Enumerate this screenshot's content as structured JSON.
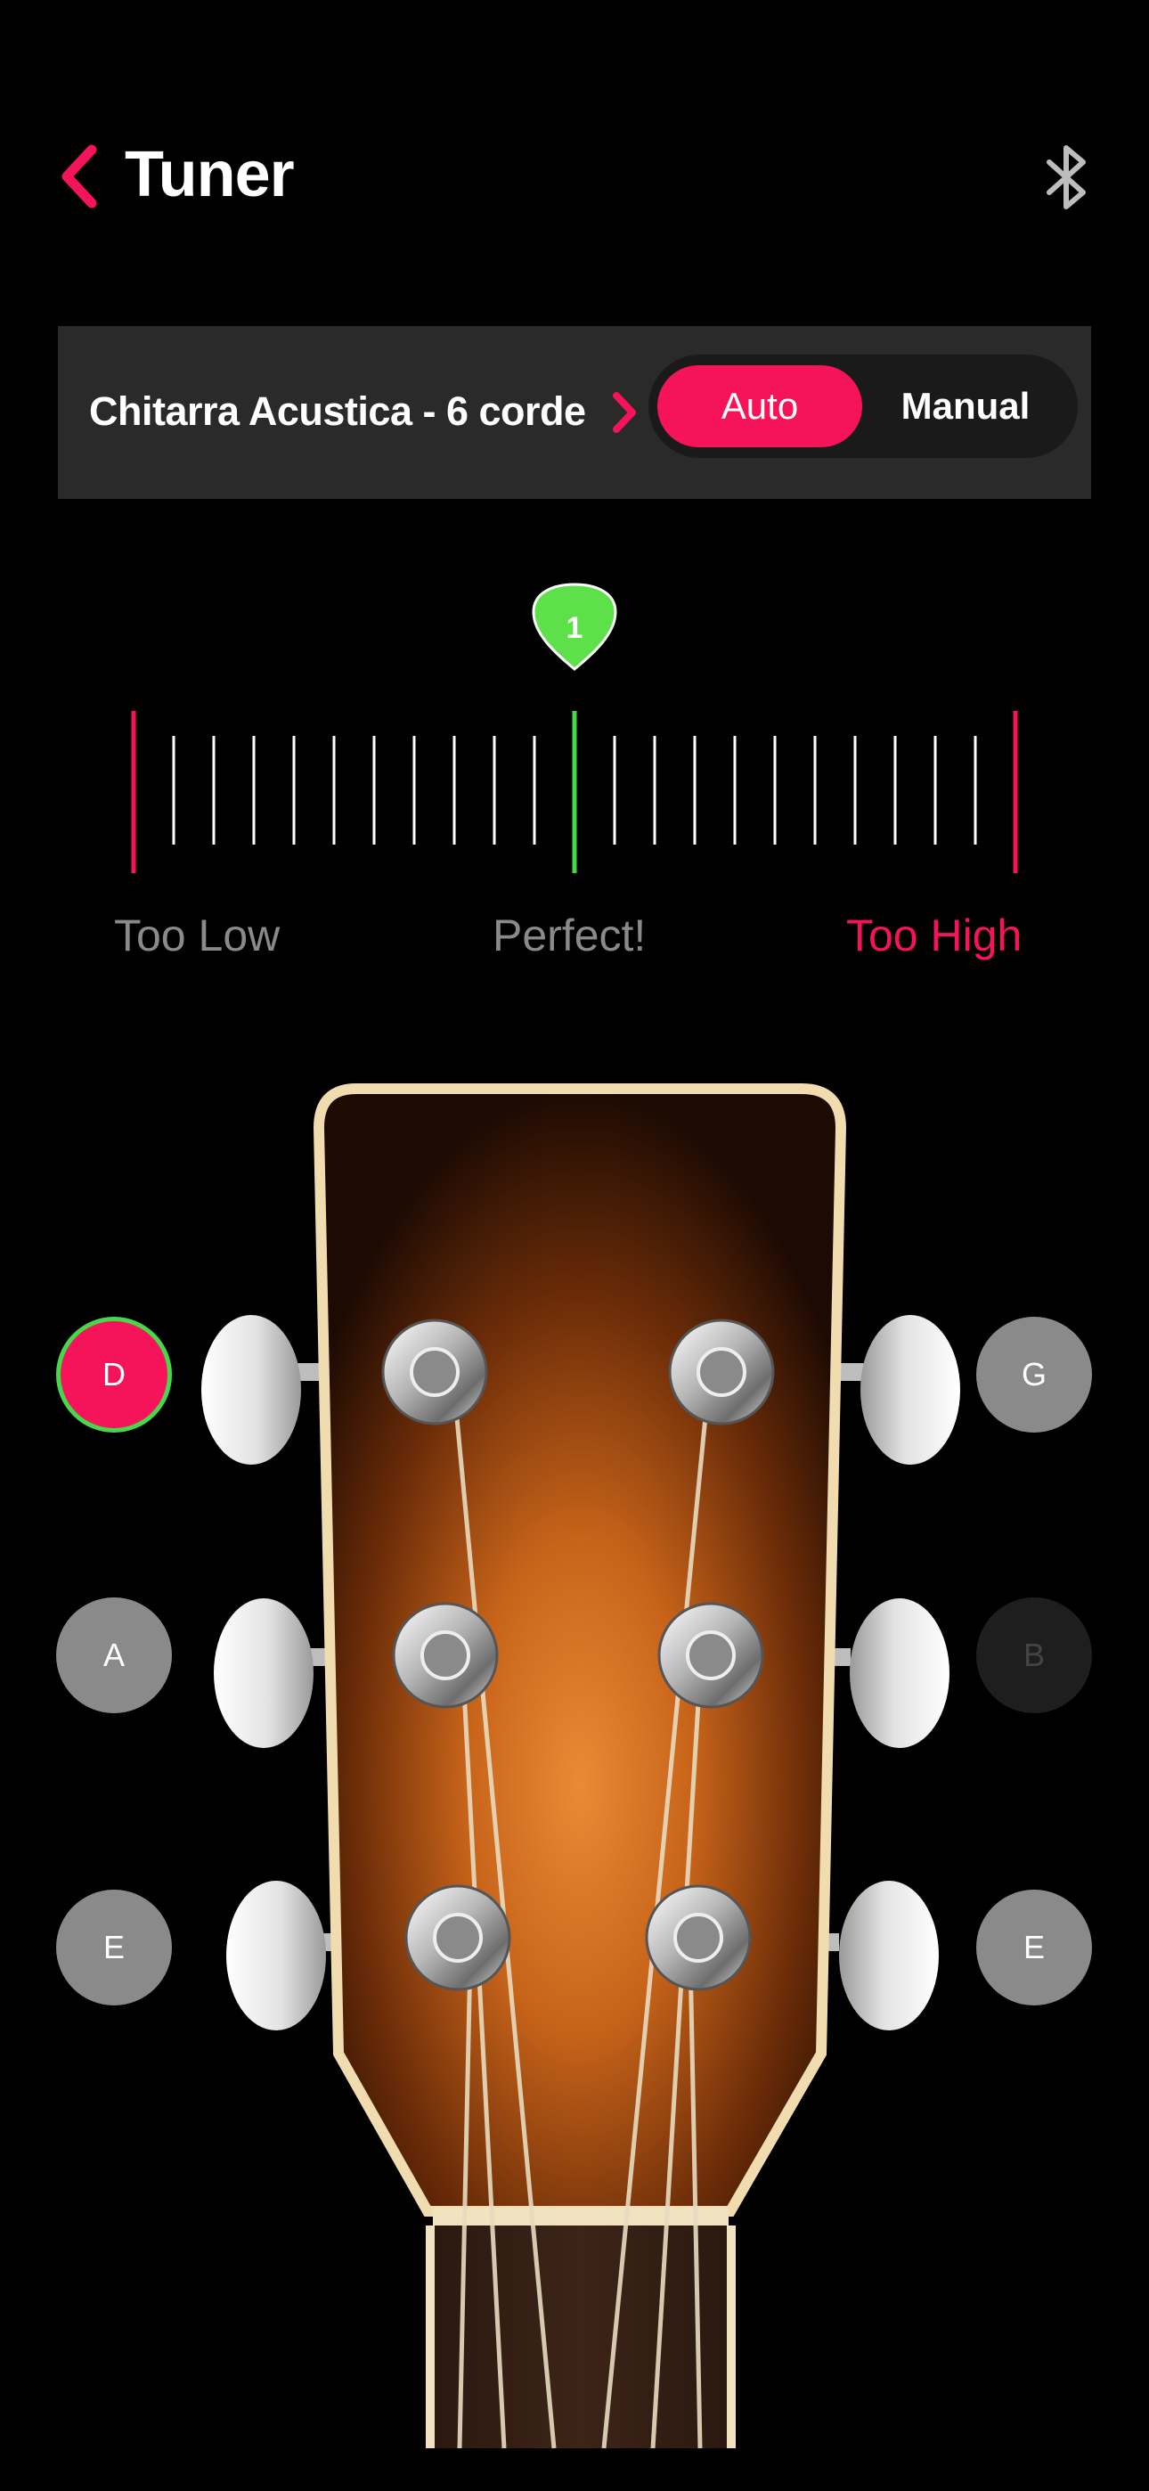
{
  "header": {
    "title": "Tuner",
    "back_icon": "chevron-left-icon",
    "bluetooth_icon": "bluetooth-icon",
    "accent_color": "#f5145a"
  },
  "instrument_bar": {
    "instrument_name": "Chitarra Acustica - 6 corde",
    "chevron_icon": "chevron-right-icon",
    "modes": {
      "auto": "Auto",
      "manual": "Manual",
      "selected": "Auto"
    }
  },
  "meter": {
    "marker_number": "1",
    "marker_color": "#5ee04a",
    "deviation_fraction": 0.0,
    "labels": {
      "low": "Too Low",
      "perfect": "Perfect!",
      "high": "Too High"
    }
  },
  "strings": {
    "left": [
      {
        "note": "D",
        "state": "active"
      },
      {
        "note": "A",
        "state": "normal"
      },
      {
        "note": "E",
        "state": "normal"
      }
    ],
    "right": [
      {
        "note": "G",
        "state": "normal"
      },
      {
        "note": "B",
        "state": "disabled"
      },
      {
        "note": "E",
        "state": "normal"
      }
    ]
  }
}
